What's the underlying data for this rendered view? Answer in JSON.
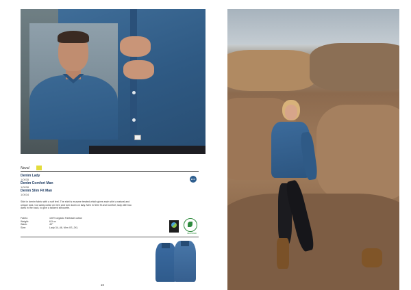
{
  "section": {
    "label": "Neval"
  },
  "products": [
    {
      "name": "Denim Lady",
      "code": "1/0035"
    },
    {
      "name": "Denim Comfort Man",
      "code": "1/0036"
    },
    {
      "name": "Denim Slim Fit Man",
      "code": "1/0034"
    }
  ],
  "badge": {
    "text": "ECO"
  },
  "description": "Shirt in denim fabric with a soft feel. The shirt is enzyme treated which gives each shirt a natural and unique look. Cut away collar on men and turn down on lady. Men in Slim fit and Comfort, lady with two darts in the back, to give a tailored silhouette.",
  "specs": [
    {
      "key": "Fabric:",
      "value": "100% organic Fairtrade cotton"
    },
    {
      "key": "Weight:",
      "value": "6,5 oz"
    },
    {
      "key": "Wash:",
      "value": "40°"
    },
    {
      "key": "Size:",
      "value": "Lady 34–46, Men XS–3XL"
    }
  ],
  "certifications": {
    "gots_caption": "CERTIFIED"
  },
  "page_number": "10",
  "colors": {
    "denim": "#2f5a84",
    "accent_yellow": "#e3dc3c",
    "cert_green": "#2e8b3d"
  }
}
